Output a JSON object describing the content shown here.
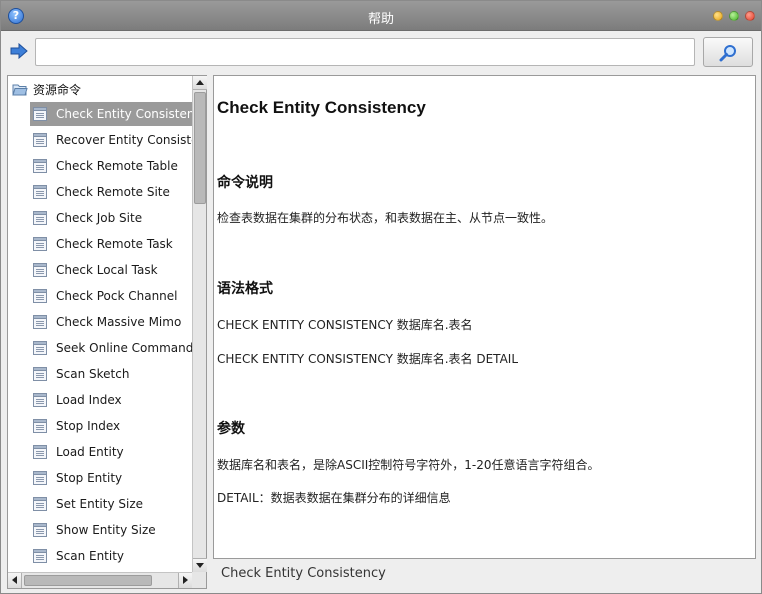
{
  "window": {
    "title": "帮助",
    "help_icon_glyph": "?"
  },
  "toolbar": {
    "search_value": "",
    "search_placeholder": ""
  },
  "tree": {
    "root_label": "资源命令",
    "selected_index": 0,
    "items": [
      "Check Entity Consistency",
      "Recover Entity Consistency",
      "Check Remote Table",
      "Check Remote Site",
      "Check Job Site",
      "Check Remote Task",
      "Check Local Task",
      "Check Pock Channel",
      "Check Massive Mimo",
      "Seek Online Command",
      "Scan Sketch",
      "Load Index",
      "Stop Index",
      "Load Entity",
      "Stop Entity",
      "Set Entity Size",
      "Show Entity Size",
      "Scan Entity"
    ]
  },
  "content": {
    "title": "Check Entity Consistency",
    "section_description": "命令说明",
    "description_text": "检查表数据在集群的分布状态，和表数据在主、从节点一致性。",
    "section_syntax": "语法格式",
    "syntax_1": "CHECK ENTITY CONSISTENCY 数据库名.表名",
    "syntax_2": "CHECK ENTITY CONSISTENCY 数据库名.表名 DETAIL",
    "section_params": "参数",
    "param_1": "数据库名和表名，是除ASCII控制符号字符外，1-20任意语言字符组合。",
    "param_2": "DETAIL：数据表数据在集群分布的详细信息"
  },
  "status": {
    "text": "Check Entity Consistency"
  },
  "colors": {
    "titlebar": "#8a8a8a",
    "selection": "#9a9a9a",
    "accent_blue": "#2f6fd0"
  }
}
